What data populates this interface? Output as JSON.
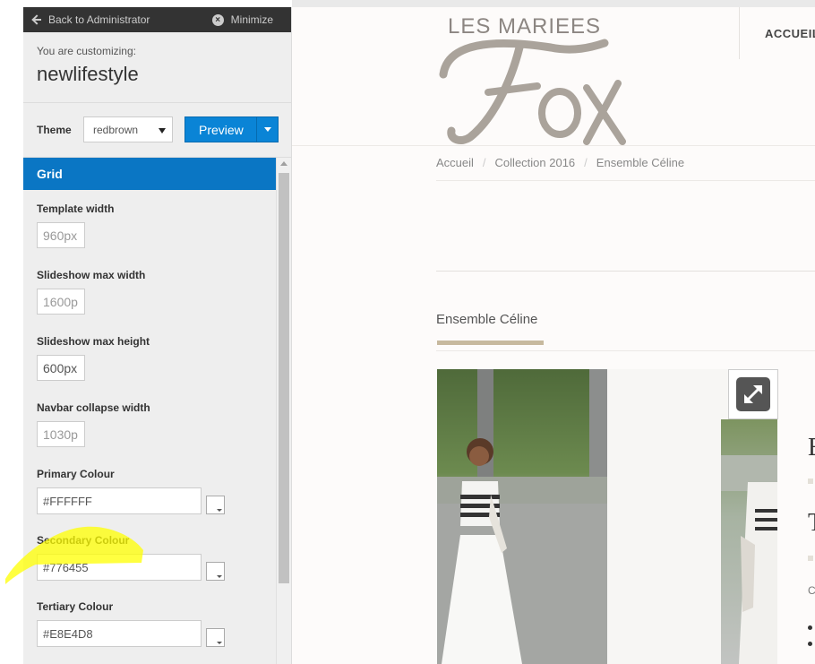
{
  "panel": {
    "back_label": "Back to Administrator",
    "minimize_label": "Minimize",
    "customizing_label": "You are customizing:",
    "site_name": "newlifestyle",
    "theme_label": "Theme",
    "theme_value": "redbrown",
    "preview_label": "Preview",
    "section_title": "Grid",
    "fields": {
      "template_width": {
        "label": "Template width",
        "value": "960px"
      },
      "slideshow_max_width": {
        "label": "Slideshow max width",
        "value": "1600p"
      },
      "slideshow_max_height": {
        "label": "Slideshow max height",
        "value": "600px"
      },
      "navbar_collapse_width": {
        "label": "Navbar collapse width",
        "value": "1030p"
      },
      "primary_colour": {
        "label": "Primary Colour",
        "value": "#FFFFFF"
      },
      "secondary_colour": {
        "label": "Secondary Colour",
        "value": "#776455"
      },
      "tertiary_colour": {
        "label": "Tertiary Colour",
        "value": "#E8E4D8"
      }
    }
  },
  "site": {
    "logo_top": "LES MARIEES",
    "logo_script": "Fox",
    "nav_first": "ACCUEIL",
    "breadcrumb": [
      "Accueil",
      "Collection 2016",
      "Ensemble Céline"
    ],
    "breadcrumb_sep": "/",
    "product_title": "Ensemble Céline",
    "cut_heading_1": "E",
    "cut_heading_2": "T",
    "cut_small": "C"
  },
  "colors": {
    "panel_bar": "#333333",
    "section_header": "#0a76c4",
    "preview_button": "#0a84d6",
    "accent_underline": "#c7b99e",
    "highlight_marker": "#ffff00"
  }
}
